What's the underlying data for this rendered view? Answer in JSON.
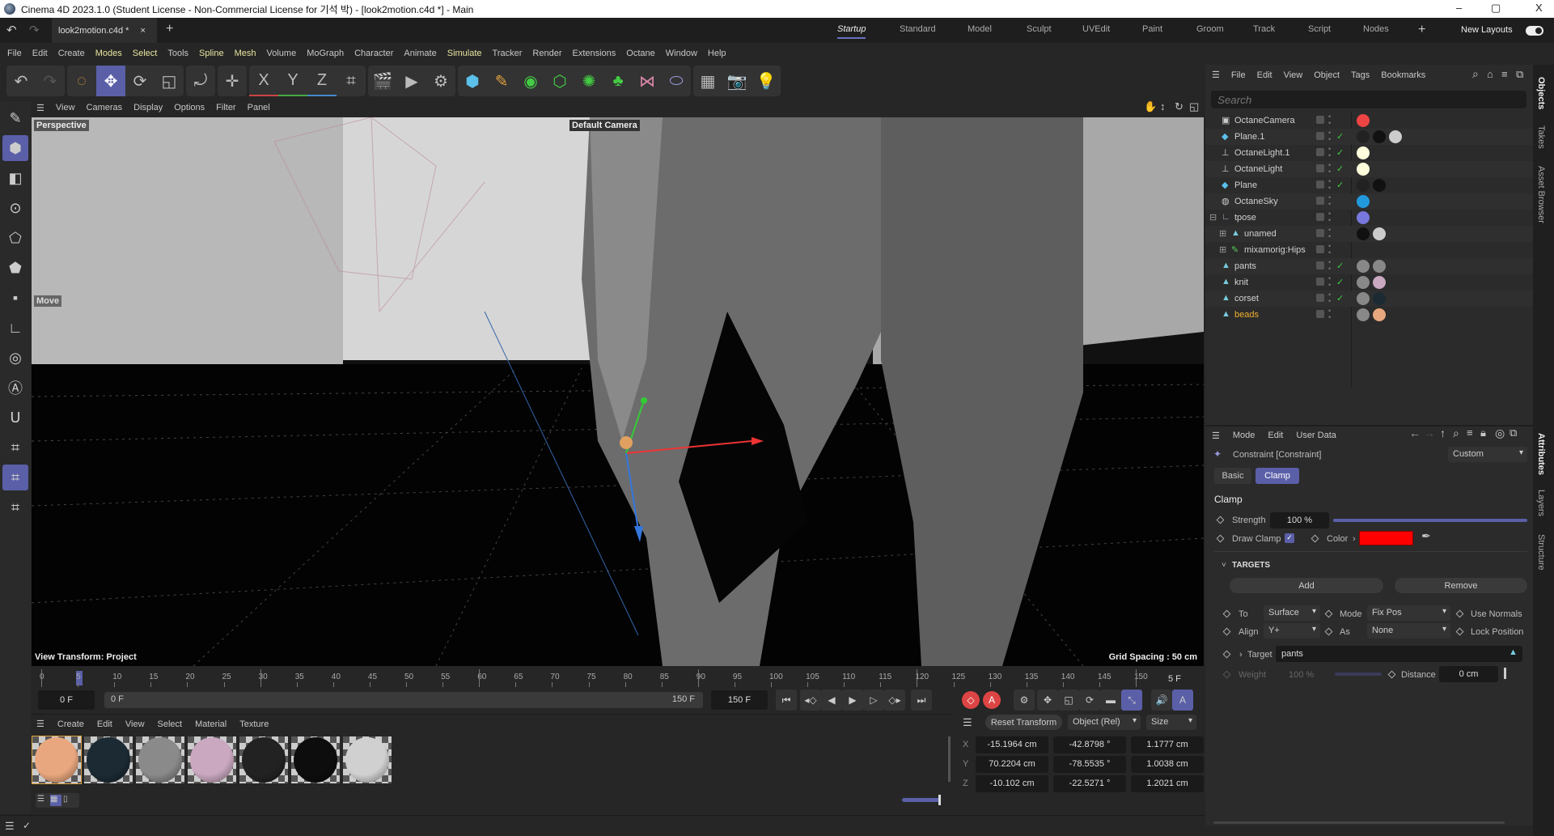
{
  "window": {
    "title": "Cinema 4D 2023.1.0 (Student License - Non-Commercial License for 기석 박) - [look2motion.c4d *] - Main",
    "minimize": "–",
    "restore": "▢",
    "close": "X"
  },
  "tabs": {
    "doc_tab": "look2motion.c4d *",
    "close": "×",
    "add": "+",
    "layouts": [
      "Startup",
      "Standard",
      "Model",
      "Sculpt",
      "UVEdit",
      "Paint",
      "Groom",
      "Track",
      "Script",
      "Nodes"
    ],
    "active_layout": "Startup",
    "new_layouts": "New Layouts"
  },
  "menu": [
    "File",
    "Edit",
    "Create",
    "Modes",
    "Select",
    "Tools",
    "Spline",
    "Mesh",
    "Volume",
    "MoGraph",
    "Character",
    "Animate",
    "Simulate",
    "Tracker",
    "Render",
    "Extensions",
    "Octane",
    "Window",
    "Help"
  ],
  "menu_highlighted": [
    "Modes",
    "Select",
    "Spline",
    "Mesh",
    "Simulate"
  ],
  "toolbar": {
    "axis_labels": [
      "X",
      "Y",
      "Z"
    ]
  },
  "viewport": {
    "menu": [
      "View",
      "Cameras",
      "Display",
      "Options",
      "Filter",
      "Panel"
    ],
    "view_name": "Perspective",
    "camera": "Default Camera",
    "tool": "Move",
    "view_transform": "View Transform: Project",
    "grid_spacing": "Grid Spacing : 50 cm"
  },
  "timeline": {
    "ticks": [
      "0",
      "5",
      "10",
      "15",
      "20",
      "25",
      "30",
      "35",
      "40",
      "45",
      "50",
      "55",
      "60",
      "65",
      "70",
      "75",
      "80",
      "85",
      "90",
      "95",
      "100",
      "105",
      "110",
      "115",
      "120",
      "125",
      "130",
      "135",
      "140",
      "145",
      "150"
    ],
    "current_frame": "5 F",
    "current_frame_value": 5,
    "start": "0 F",
    "range_start": "0 F",
    "range_end": "150 F",
    "end": "150 F"
  },
  "materials": {
    "menu": [
      "Create",
      "Edit",
      "View",
      "Select",
      "Material",
      "Texture"
    ],
    "swatches": [
      "#e8a77e",
      "#1c2a33",
      "#8a8a8a",
      "#c9a8c0",
      "#222222",
      "#0d0d0d",
      "#d0d0d0"
    ]
  },
  "coords": {
    "reset": "Reset Transform",
    "mode": "Object (Rel)",
    "size_mode": "Size",
    "rows": [
      {
        "axis": "X",
        "pos": "-15.1964 cm",
        "rot": "-42.8798 °",
        "size": "1.1777 cm"
      },
      {
        "axis": "Y",
        "pos": "70.2204 cm",
        "rot": "-78.5535 °",
        "size": "1.0038 cm"
      },
      {
        "axis": "Z",
        "pos": "-10.102 cm",
        "rot": "-22.5271 °",
        "size": "1.2021 cm"
      }
    ]
  },
  "objects": {
    "menu": [
      "File",
      "Edit",
      "View",
      "Object",
      "Tags",
      "Bookmarks"
    ],
    "search_placeholder": "Search",
    "items": [
      {
        "name": "OctaneCamera",
        "indent": 0,
        "check": false
      },
      {
        "name": "Plane.1",
        "indent": 0,
        "check": true
      },
      {
        "name": "OctaneLight.1",
        "indent": 0,
        "check": true
      },
      {
        "name": "OctaneLight",
        "indent": 0,
        "check": true
      },
      {
        "name": "Plane",
        "indent": 0,
        "check": true
      },
      {
        "name": "OctaneSky",
        "indent": 0,
        "check": false
      },
      {
        "name": "tpose",
        "indent": 0,
        "check": false
      },
      {
        "name": "unamed",
        "indent": 1,
        "check": false
      },
      {
        "name": "mixamorig:Hips",
        "indent": 1,
        "check": false
      },
      {
        "name": "pants",
        "indent": 0,
        "check": true
      },
      {
        "name": "knit",
        "indent": 0,
        "check": true
      },
      {
        "name": "corset",
        "indent": 0,
        "check": true
      },
      {
        "name": "beads",
        "indent": 0,
        "check": false,
        "selected": true
      }
    ]
  },
  "side_tabs": [
    "Objects",
    "Takes",
    "Asset Browser",
    "Attributes",
    "Layers",
    "Structure"
  ],
  "attributes": {
    "menu": [
      "Mode",
      "Edit",
      "User Data"
    ],
    "object": "Constraint [Constraint]",
    "preset": "Custom",
    "tabs": [
      "Basic",
      "Clamp"
    ],
    "active_tab": "Clamp",
    "section": "Clamp",
    "strength_label": "Strength",
    "strength": "100 %",
    "strength_value": 100,
    "draw_clamp_label": "Draw Clamp",
    "draw_clamp": true,
    "color_label": "Color",
    "color": "#ff0000",
    "targets_label": "TARGETS",
    "add": "Add",
    "remove": "Remove",
    "to_label": "To",
    "to": "Surface",
    "mode_label": "Mode",
    "mode": "Fix Pos",
    "use_normals": "Use Normals",
    "align_label": "Align",
    "align": "Y+",
    "as_label": "As",
    "as": "None",
    "lock_position": "Lock Position",
    "target_label": "Target",
    "target": "pants",
    "weight_label": "Weight",
    "weight": "100 %",
    "distance_label": "Distance",
    "distance": "0 cm"
  }
}
